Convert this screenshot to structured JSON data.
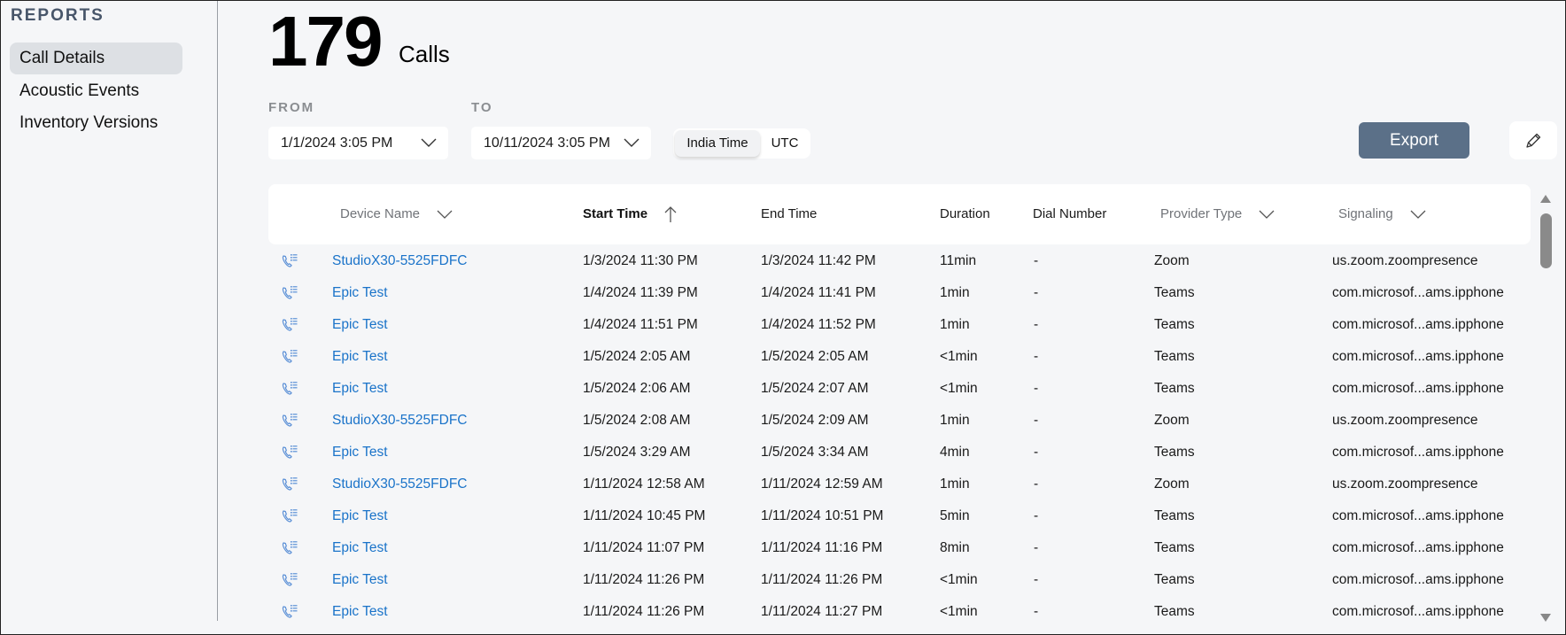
{
  "sidebar": {
    "heading": "REPORTS",
    "items": [
      {
        "label": "Call Details",
        "active": true
      },
      {
        "label": "Acoustic Events",
        "active": false
      },
      {
        "label": "Inventory Versions",
        "active": false
      }
    ]
  },
  "summary": {
    "count": "179",
    "count_label": "Calls"
  },
  "filters": {
    "from_label": "FROM",
    "from_value": "1/1/2024 3:05 PM",
    "to_label": "TO",
    "to_value": "10/11/2024 3:05 PM",
    "timezone_options": [
      "India Time",
      "UTC"
    ],
    "timezone_selected": "India Time"
  },
  "toolbar": {
    "export_label": "Export",
    "edit_icon": "pencil-icon"
  },
  "table": {
    "columns": [
      {
        "label": "Device Name",
        "sort": "dropdown"
      },
      {
        "label": "Start Time",
        "sort": "ascending"
      },
      {
        "label": "End Time"
      },
      {
        "label": "Duration"
      },
      {
        "label": "Dial Number"
      },
      {
        "label": "Provider Type",
        "sort": "dropdown"
      },
      {
        "label": "Signaling",
        "sort": "dropdown"
      }
    ],
    "row_icon": "call-details-icon",
    "rows": [
      {
        "device": "StudioX30-5525FDFC",
        "start": "1/3/2024 11:30 PM",
        "end": "1/3/2024 11:42 PM",
        "duration": "11min",
        "dial": "-",
        "provider": "Zoom",
        "signaling": "us.zoom.zoompresence"
      },
      {
        "device": "Epic Test",
        "start": "1/4/2024 11:39 PM",
        "end": "1/4/2024 11:41 PM",
        "duration": "1min",
        "dial": "-",
        "provider": "Teams",
        "signaling": "com.microsof...ams.ipphone"
      },
      {
        "device": "Epic Test",
        "start": "1/4/2024 11:51 PM",
        "end": "1/4/2024 11:52 PM",
        "duration": "1min",
        "dial": "-",
        "provider": "Teams",
        "signaling": "com.microsof...ams.ipphone"
      },
      {
        "device": "Epic Test",
        "start": "1/5/2024 2:05 AM",
        "end": "1/5/2024 2:05 AM",
        "duration": "<1min",
        "dial": "-",
        "provider": "Teams",
        "signaling": "com.microsof...ams.ipphone"
      },
      {
        "device": "Epic Test",
        "start": "1/5/2024 2:06 AM",
        "end": "1/5/2024 2:07 AM",
        "duration": "<1min",
        "dial": "-",
        "provider": "Teams",
        "signaling": "com.microsof...ams.ipphone"
      },
      {
        "device": "StudioX30-5525FDFC",
        "start": "1/5/2024 2:08 AM",
        "end": "1/5/2024 2:09 AM",
        "duration": "1min",
        "dial": "-",
        "provider": "Zoom",
        "signaling": "us.zoom.zoompresence"
      },
      {
        "device": "Epic Test",
        "start": "1/5/2024 3:29 AM",
        "end": "1/5/2024 3:34 AM",
        "duration": "4min",
        "dial": "-",
        "provider": "Teams",
        "signaling": "com.microsof...ams.ipphone"
      },
      {
        "device": "StudioX30-5525FDFC",
        "start": "1/11/2024 12:58 AM",
        "end": "1/11/2024 12:59 AM",
        "duration": "1min",
        "dial": "-",
        "provider": "Zoom",
        "signaling": "us.zoom.zoompresence"
      },
      {
        "device": "Epic Test",
        "start": "1/11/2024 10:45 PM",
        "end": "1/11/2024 10:51 PM",
        "duration": "5min",
        "dial": "-",
        "provider": "Teams",
        "signaling": "com.microsof...ams.ipphone"
      },
      {
        "device": "Epic Test",
        "start": "1/11/2024 11:07 PM",
        "end": "1/11/2024 11:16 PM",
        "duration": "8min",
        "dial": "-",
        "provider": "Teams",
        "signaling": "com.microsof...ams.ipphone"
      },
      {
        "device": "Epic Test",
        "start": "1/11/2024 11:26 PM",
        "end": "1/11/2024 11:26 PM",
        "duration": "<1min",
        "dial": "-",
        "provider": "Teams",
        "signaling": "com.microsof...ams.ipphone"
      },
      {
        "device": "Epic Test",
        "start": "1/11/2024 11:26 PM",
        "end": "1/11/2024 11:27 PM",
        "duration": "<1min",
        "dial": "-",
        "provider": "Teams",
        "signaling": "com.microsof...ams.ipphone"
      }
    ]
  },
  "colors": {
    "link": "#1a73c9",
    "export_button": "#5b7088",
    "active_sidebar": "#dde0e4",
    "background": "#f5f6f8"
  }
}
